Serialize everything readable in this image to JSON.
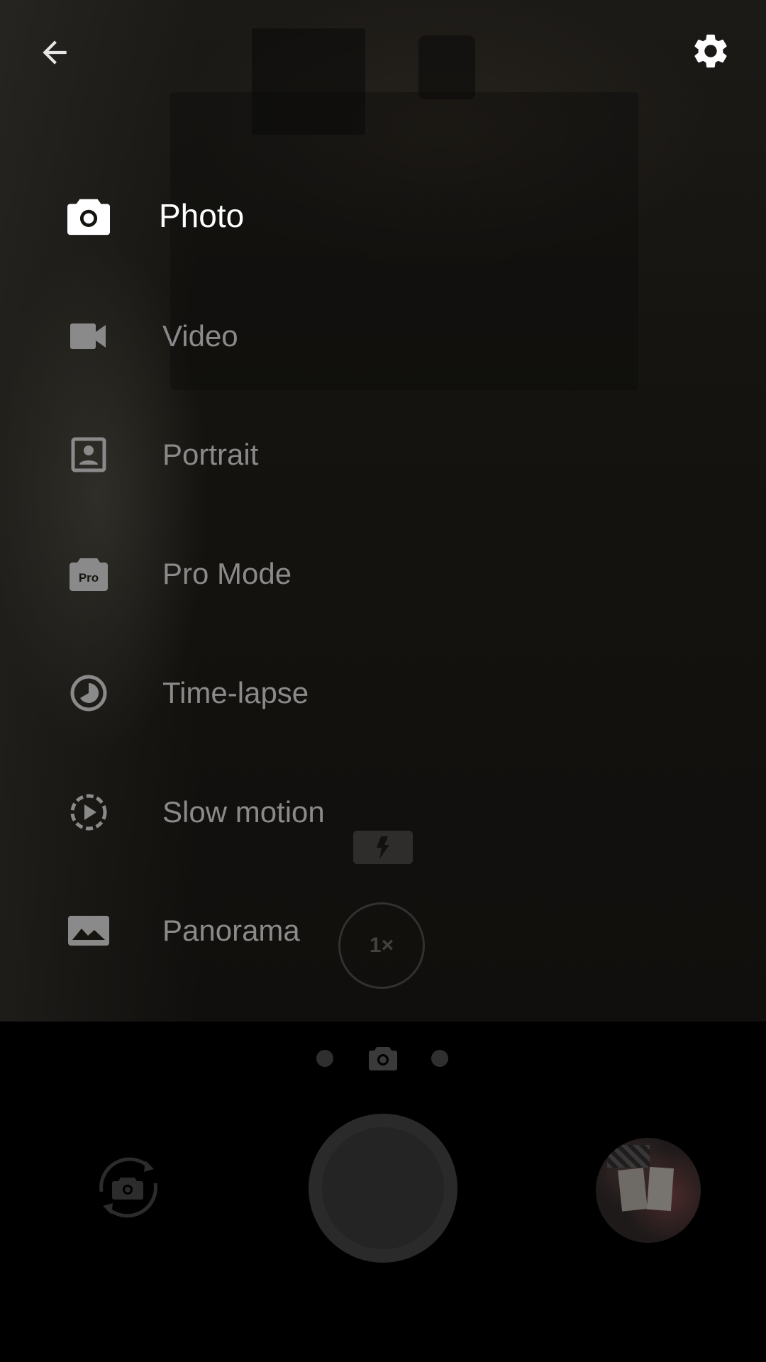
{
  "top_bar": {
    "back_icon": "arrow-back-icon",
    "settings_icon": "gear-icon"
  },
  "modes": [
    {
      "label": "Photo",
      "icon": "camera-icon",
      "active": true
    },
    {
      "label": "Video",
      "icon": "videocam-icon",
      "active": false
    },
    {
      "label": "Portrait",
      "icon": "portrait-icon",
      "active": false
    },
    {
      "label": "Pro Mode",
      "icon": "pro-camera-icon",
      "active": false
    },
    {
      "label": "Time-lapse",
      "icon": "timelapse-icon",
      "active": false
    },
    {
      "label": "Slow motion",
      "icon": "slow-motion-icon",
      "active": false
    },
    {
      "label": "Panorama",
      "icon": "panorama-icon",
      "active": false
    }
  ],
  "pro_badge": "Pro",
  "viewfinder": {
    "flash_icon": "flash-icon",
    "zoom_label": "1×"
  },
  "controls": {
    "switch_camera_icon": "switch-camera-icon",
    "shutter": "shutter-button",
    "gallery": "gallery-thumbnail"
  },
  "colors": {
    "active_label": "#ffffff",
    "inactive_label": "#8a8a8a",
    "background": "#000000"
  }
}
